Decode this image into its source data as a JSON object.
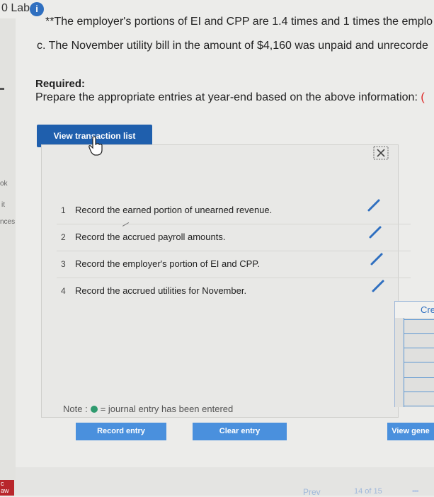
{
  "header": {
    "title": "0 Lab",
    "info_badge": "i"
  },
  "left_rail": {
    "labels": [
      "ok",
      "it",
      "nces"
    ],
    "bottom_badge": "c\naw"
  },
  "question": {
    "note_line": "**The employer's portions of EI and CPP are 1.4 times and 1 times the emplo",
    "item_c": "c. The November utility bill in the amount of $4,160 was unpaid and unrecorde",
    "required_label": "Required:",
    "instruction": "Prepare the appropriate entries at year-end based on the above information: ",
    "instruction_tail": "("
  },
  "toolbar": {
    "view_transaction_list": "View transaction list"
  },
  "transactions": [
    {
      "number": "1",
      "text": "Record the earned portion of unearned revenue."
    },
    {
      "number": "2",
      "text": "Record the accrued payroll amounts."
    },
    {
      "number": "3",
      "text": "Record the employer's portion of EI and CPP."
    },
    {
      "number": "4",
      "text": "Record the accrued utilities for November."
    }
  ],
  "right_panel": {
    "tab_label": "Cre"
  },
  "note": {
    "prefix": "Note :",
    "suffix": "= journal entry has been entered"
  },
  "actions": {
    "record_entry": "Record entry",
    "clear_entry": "Clear entry",
    "view_general": "View gene"
  },
  "footer": {
    "prev": "Prev",
    "pager": "14 of 15"
  },
  "colors": {
    "accent": "#1f5fad",
    "button": "#4a90dd",
    "entered_dot": "#2e9a6e",
    "pencil": "#2f6fc0"
  }
}
